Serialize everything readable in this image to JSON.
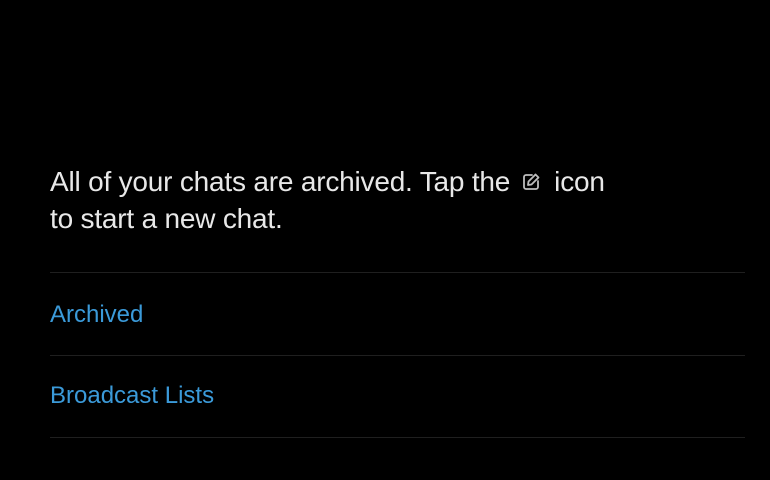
{
  "empty_state": {
    "message_part1": "All of your chats are archived. Tap the",
    "icon": "compose-icon",
    "message_part2": "icon",
    "message_line2": "to start a new chat."
  },
  "list": {
    "items": [
      {
        "label": "Archived"
      },
      {
        "label": "Broadcast Lists"
      }
    ]
  },
  "colors": {
    "background": "#000000",
    "text": "#e8e8e8",
    "link": "#3b9ad9",
    "divider": "#1f1f1f"
  }
}
